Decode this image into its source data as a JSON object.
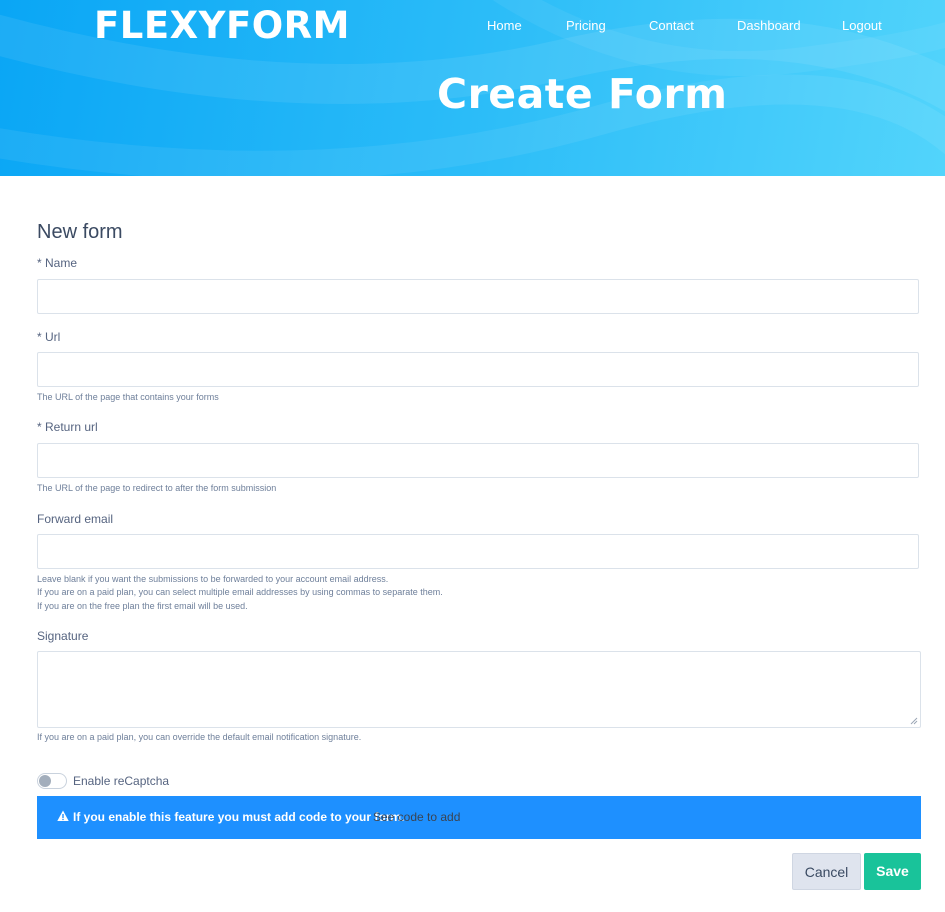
{
  "colors": {
    "header_gradient_start": "#0aa6f5",
    "header_gradient_end": "#52d4fb",
    "alert_bg": "#1e90ff",
    "save_button": "#19c39a",
    "cancel_button": "#dfe4ee"
  },
  "header": {
    "logo": "FLEXYFORM",
    "nav": [
      "Home",
      "Pricing",
      "Contact",
      "Dashboard",
      "Logout"
    ],
    "title": "Create Form"
  },
  "form": {
    "title": "New form",
    "name": {
      "label": "* Name",
      "value": ""
    },
    "url": {
      "label": "* Url",
      "value": "",
      "help": "The URL of the page that contains your forms"
    },
    "return_url": {
      "label": "* Return url",
      "value": "",
      "help": "The URL of the page to redirect to after the form submission"
    },
    "forward_email": {
      "label": "Forward email",
      "value": "",
      "help": [
        "Leave blank if you want the submissions to be forwarded to your account email address.",
        "If you are on a paid plan, you can select multiple email addresses by using commas to separate them.",
        "If you are on the free plan the first email will be used."
      ]
    },
    "signature": {
      "label": "Signature",
      "value": "",
      "help": "If you are on a paid plan, you can override the default email notification signature."
    },
    "recaptcha": {
      "label": "Enable reCaptcha",
      "enabled": false
    },
    "alert": {
      "icon": "warning-icon",
      "text": "If you enable this feature you must add code to your form.",
      "link": "See code to add"
    },
    "buttons": {
      "cancel": "Cancel",
      "save": "Save"
    }
  }
}
